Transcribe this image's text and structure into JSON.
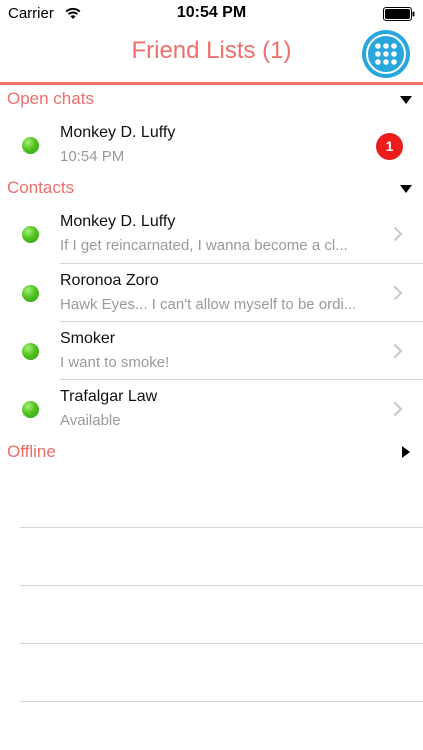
{
  "status_bar": {
    "carrier": "Carrier",
    "time": "10:54 PM"
  },
  "nav": {
    "title": "Friend Lists (1)"
  },
  "sections": {
    "open_chats": {
      "title": "Open chats",
      "items": [
        {
          "name": "Monkey D. Luffy",
          "subtitle": "10:54 PM",
          "badge": "1"
        }
      ]
    },
    "contacts": {
      "title": "Contacts",
      "items": [
        {
          "name": "Monkey D. Luffy",
          "subtitle": "If I get reincarnated, I wanna become a cl..."
        },
        {
          "name": "Roronoa Zoro",
          "subtitle": "Hawk Eyes... I can't allow myself to be ordi..."
        },
        {
          "name": "Smoker",
          "subtitle": "I want to smoke!"
        },
        {
          "name": "Trafalgar Law",
          "subtitle": "Available"
        }
      ]
    },
    "offline": {
      "title": "Offline"
    }
  },
  "colors": {
    "accent": "#ee6e6b",
    "button": "#28a7de",
    "online": "#52c420",
    "badge": "#ec1c1c"
  },
  "icons": {
    "wifi": "wifi-icon",
    "battery": "battery-icon",
    "grid": "grid-dots-icon",
    "chevron": "chevron-right-icon"
  }
}
